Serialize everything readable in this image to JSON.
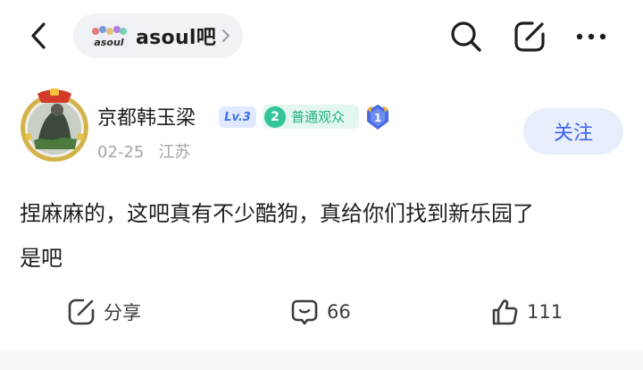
{
  "topbar": {
    "forum_name": "asoul吧",
    "forum_logo_text": "asoul",
    "icons": [
      "back-arrow-icon",
      "search-icon",
      "edit-share-icon",
      "more-icon"
    ]
  },
  "author": {
    "name": "京都韩玉梁",
    "level": "Lv.3",
    "rank_number": "2",
    "rank_title": "普通观众",
    "medal_number": "1",
    "date": "02-25",
    "location": "江苏",
    "follow_label": "关注"
  },
  "post": {
    "line1": "捏麻麻的，这吧真有不少酷狗，真给你们找到新乐园了",
    "line2": "是吧"
  },
  "actions": {
    "share_label": "分享",
    "comment_count": "66",
    "like_count": "111"
  },
  "colors": {
    "accent": "#3a64f0",
    "rank_green": "#20b182",
    "muted": "#a2a5ab"
  }
}
